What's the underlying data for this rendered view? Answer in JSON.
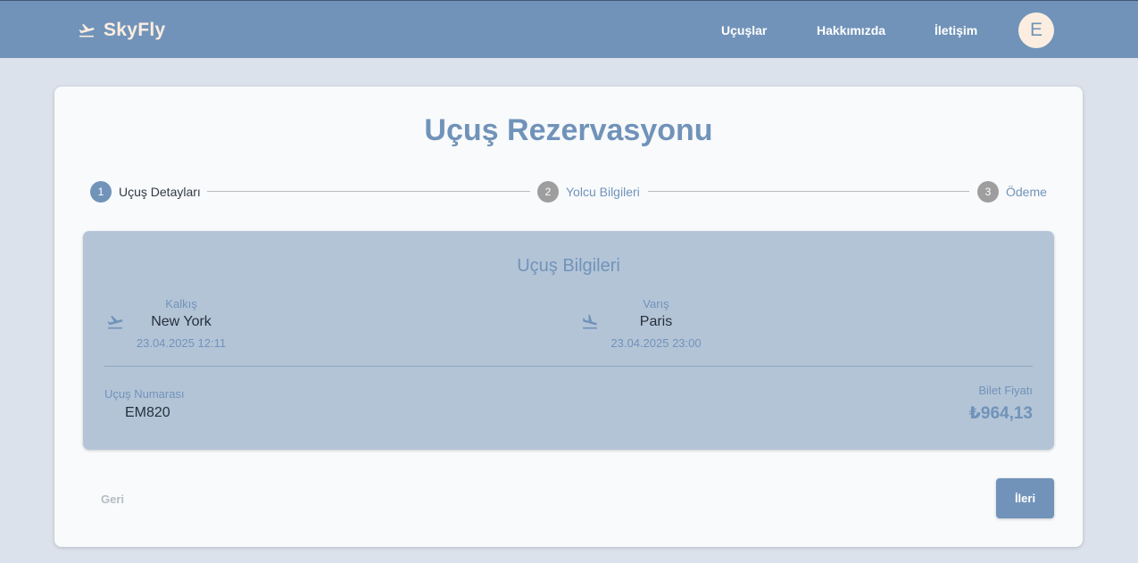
{
  "navbar": {
    "brand_icon": "flight-takeoff-icon",
    "brand_name": "SkyFly",
    "links": [
      "Uçuşlar",
      "Hakkımızda",
      "İletişim"
    ],
    "avatar_initial": "E",
    "colors": {
      "bar": "#7193b9",
      "brand": "#fbeee0"
    }
  },
  "page": {
    "title": "Uçuş Rezervasyonu"
  },
  "stepper": {
    "active_step": 1,
    "steps": [
      {
        "number": "1",
        "label": "Uçuş Detayları"
      },
      {
        "number": "2",
        "label": "Yolcu Bilgileri"
      },
      {
        "number": "3",
        "label": "Ödeme"
      }
    ]
  },
  "flight_info": {
    "title": "Uçuş Bilgileri",
    "departure": {
      "icon": "flight-takeoff-icon",
      "label": "Kalkış",
      "city": "New York",
      "datetime": "23.04.2025 12:11"
    },
    "arrival": {
      "icon": "flight-land-icon",
      "label": "Varış",
      "city": "Paris",
      "datetime": "23.04.2025 23:00"
    },
    "flight_number_label": "Uçuş Numarası",
    "flight_number": "EM820",
    "price_label": "Bilet Fiyatı",
    "price": "₺964,13"
  },
  "actions": {
    "back_label": "Geri",
    "next_label": "İleri"
  }
}
